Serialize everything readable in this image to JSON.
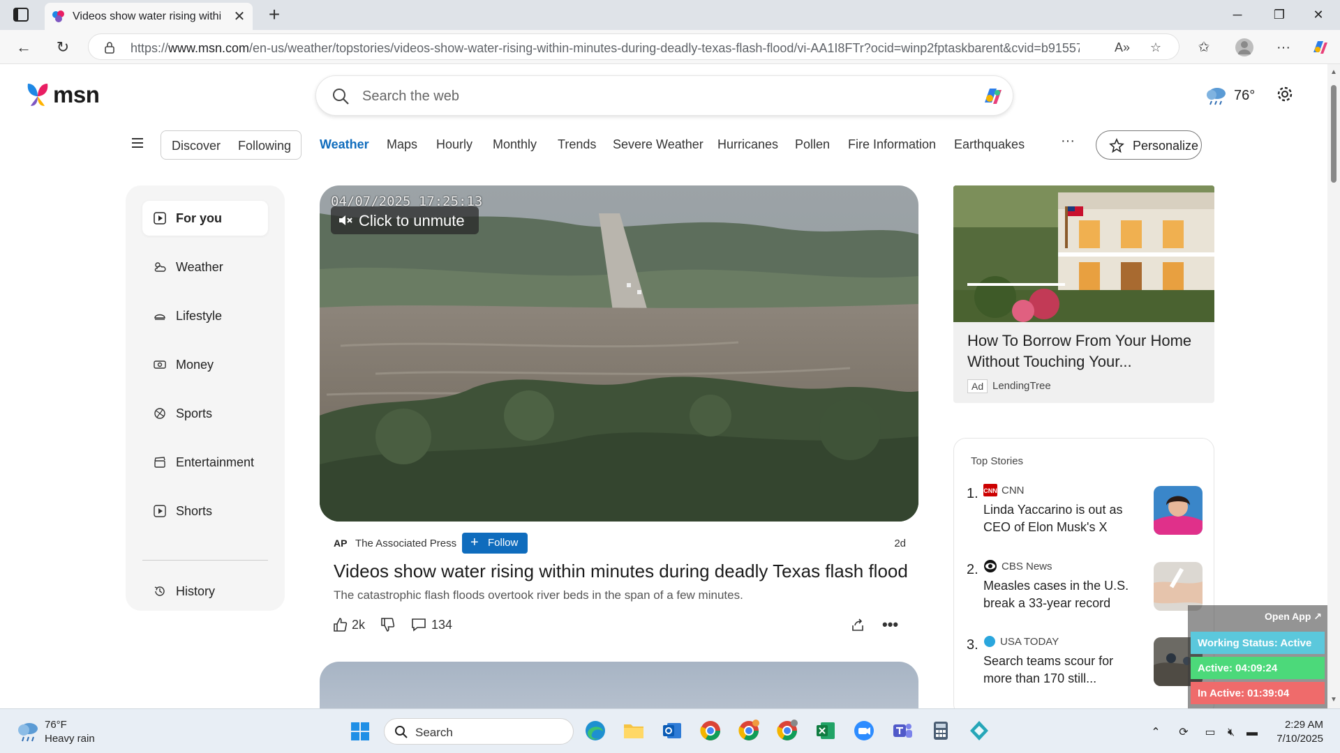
{
  "browser": {
    "tab_title": "Videos show water rising within minutes during deadly Texas flash flood",
    "url_host_prefix": "https://",
    "url_host": "www.msn.com",
    "url_path": "/en-us/weather/topstories/videos-show-water-rising-within-minutes-during-deadly-texas-flash-flood/vi-AA1I8FTr?ocid=winp2fptaskbarent&cvid=b915570b..."
  },
  "header": {
    "logo_text": "msn",
    "search_placeholder": "Search the web",
    "temperature": "76°"
  },
  "nav": {
    "discover": "Discover",
    "following": "Following",
    "links": [
      "Weather",
      "Maps",
      "Hourly",
      "Monthly",
      "Trends",
      "Severe Weather",
      "Hurricanes",
      "Pollen",
      "Fire Information",
      "Earthquakes"
    ],
    "more": "···",
    "personalize": "Personalize"
  },
  "sidebar": {
    "items": [
      {
        "label": "For you"
      },
      {
        "label": "Weather"
      },
      {
        "label": "Lifestyle"
      },
      {
        "label": "Money"
      },
      {
        "label": "Sports"
      },
      {
        "label": "Entertainment"
      },
      {
        "label": "Shorts"
      },
      {
        "label": "History"
      }
    ]
  },
  "video": {
    "timestamp": "04/07/2025 17:25:13",
    "unmute": "Click to unmute"
  },
  "article": {
    "source_logo": "AP",
    "source": "The Associated Press",
    "follow": "Follow",
    "age": "2d",
    "headline": "Videos show water rising within minutes during deadly Texas flash flood",
    "subline": "The catastrophic flash floods overtook river beds in the span of a few minutes.",
    "likes": "2k",
    "comments": "134"
  },
  "ad": {
    "title": "How To Borrow From Your Home Without Touching Your...",
    "badge": "Ad",
    "source": "LendingTree"
  },
  "top_stories": {
    "title": "Top Stories",
    "items": [
      {
        "num": "1.",
        "source": "CNN",
        "title": "Linda Yaccarino is out as CEO of Elon Musk's X"
      },
      {
        "num": "2.",
        "source": "CBS News",
        "title": "Measles cases in the U.S. break a 33-year record"
      },
      {
        "num": "3.",
        "source": "USA TODAY",
        "title": "Search teams scour for more than 170 still..."
      }
    ]
  },
  "widget": {
    "open_app": "Open App ↗",
    "status": "Working Status: Active",
    "active": "Active: 04:09:24",
    "inactive": "In Active: 01:39:04"
  },
  "taskbar": {
    "temp": "76°F",
    "condition": "Heavy rain",
    "search": "Search",
    "time": "2:29 AM",
    "date": "7/10/2025"
  },
  "colors": {
    "accent": "#0f6cbd",
    "widget_status": "#5bc8dc",
    "widget_active": "#4cd97a",
    "widget_inactive": "#ef6b6b"
  }
}
